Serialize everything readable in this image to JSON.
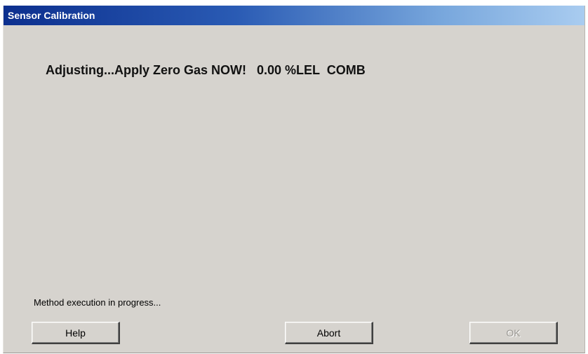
{
  "window": {
    "title": "Sensor Calibration"
  },
  "main": {
    "status_message": "Adjusting...Apply Zero Gas NOW!   0.00 %LEL  COMB",
    "progress_text": "Method execution in progress..."
  },
  "buttons": {
    "help_label": "Help",
    "abort_label": "Abort",
    "ok_label": "OK",
    "ok_enabled": false
  },
  "colors": {
    "title_bar_start": "#0c2f8e",
    "title_bar_end": "#a9ccf0",
    "dialog_background": "#d6d3ce",
    "disabled_text": "#9a9893"
  }
}
